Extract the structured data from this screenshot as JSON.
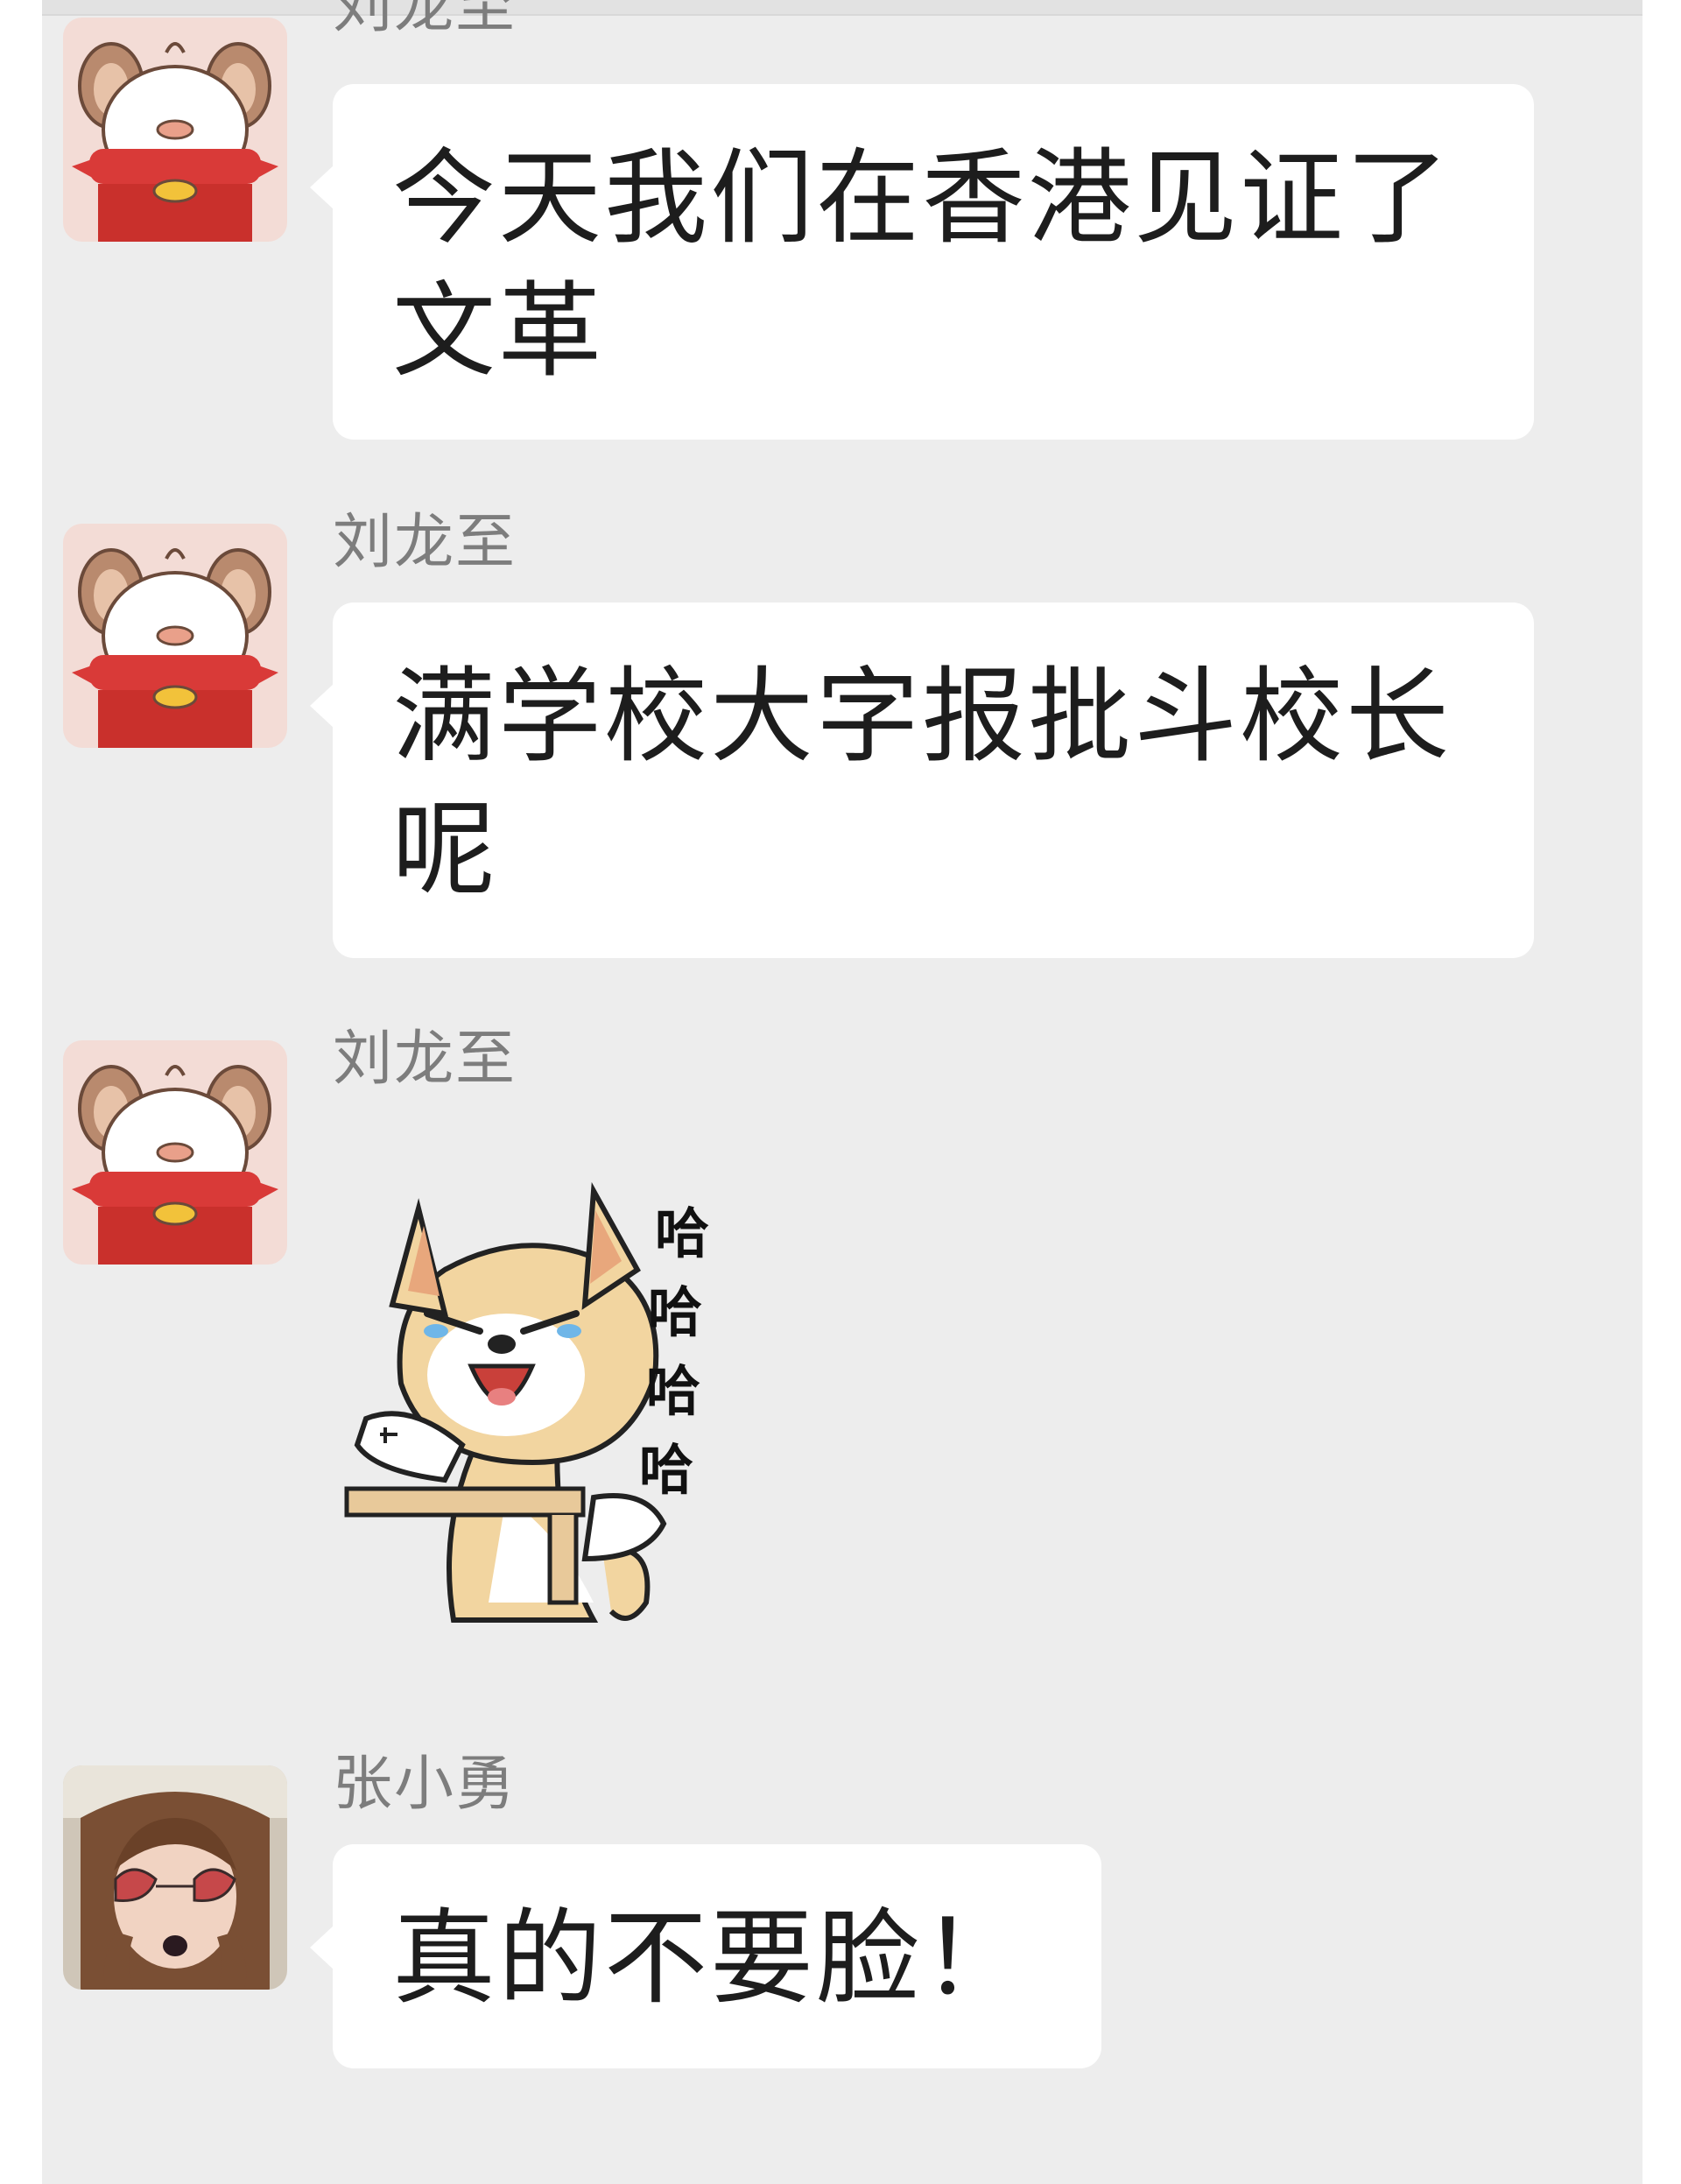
{
  "messages": [
    {
      "sender": "刘龙至",
      "lines": [
        "今天我们在香港见证了",
        "文革"
      ]
    },
    {
      "sender": "刘龙至",
      "lines": [
        "满学校大字报批斗校长",
        "呢"
      ]
    },
    {
      "sender": "刘龙至",
      "sticker": {
        "text": [
          "哈",
          "哈",
          "哈",
          "哈"
        ],
        "icon": "shiba-dog-laughing-sticker"
      }
    },
    {
      "sender": "张小勇",
      "lines": [
        "真的不要脸！"
      ]
    }
  ],
  "colors": {
    "background": "#ededed",
    "bubble": "#ffffff",
    "name": "#7d7d7d",
    "text": "#1d1d1d"
  }
}
